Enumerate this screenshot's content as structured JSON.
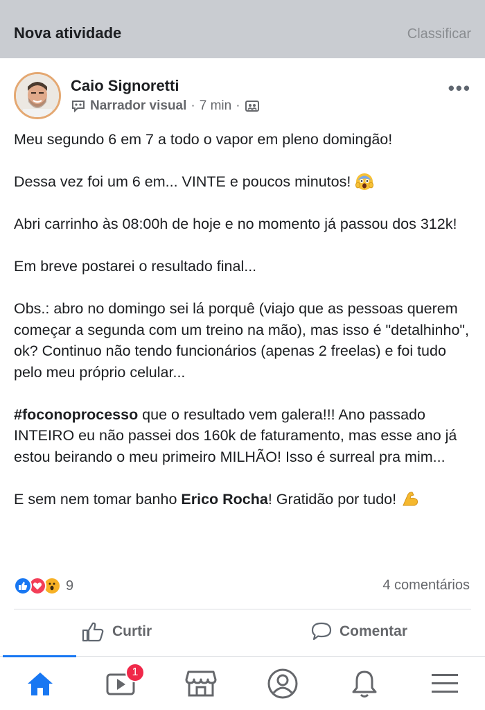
{
  "header": {
    "title": "Nova atividade",
    "sort_label": "Classificar"
  },
  "post": {
    "author": "Caio Signoretti",
    "narrator": "Narrador visual",
    "time": "7 min",
    "separator": "·",
    "more_label": "•••",
    "lines": {
      "l1": "Meu segundo 6 em 7 a todo o vapor em pleno domingão!",
      "l2": "Dessa vez foi um 6 em... VINTE e poucos minutos!",
      "l3": "Abri carrinho às 08:00h de hoje e no momento já passou dos 312k!",
      "l4": "Em breve postarei o resultado final...",
      "l5": "Obs.: abro no domingo sei lá porquê (viajo que as pessoas querem começar a segunda com um treino na mão), mas isso é \"detalhinho\", ok? Continuo não tendo funcionários (apenas 2 freelas) e foi tudo pelo meu próprio celular...",
      "l6_hashtag": "#foconoprocesso",
      "l6_rest": " que o resultado vem galera!!! Ano passado INTEIRO eu não passei dos 160k de faturamento, mas esse ano já estou beirando o meu primeiro MILHÃO! Isso é surreal pra mim...",
      "l7_pre": "E sem nem tomar banho ",
      "l7_name": "Erico Rocha",
      "l7_post": "! Gratidão por tudo!"
    },
    "reaction_count": "9",
    "comments_count": "4 comentários",
    "actions": {
      "like": "Curtir",
      "comment": "Comentar"
    }
  },
  "tabbar": {
    "items": [
      "home-icon",
      "watch-icon",
      "marketplace-icon",
      "profile-icon",
      "notifications-icon",
      "menu-icon"
    ],
    "watch_badge": "1"
  },
  "colors": {
    "accent": "#1877f2",
    "badge": "#f02849",
    "header_bg": "#c9ccd1",
    "muted": "#65676b"
  }
}
